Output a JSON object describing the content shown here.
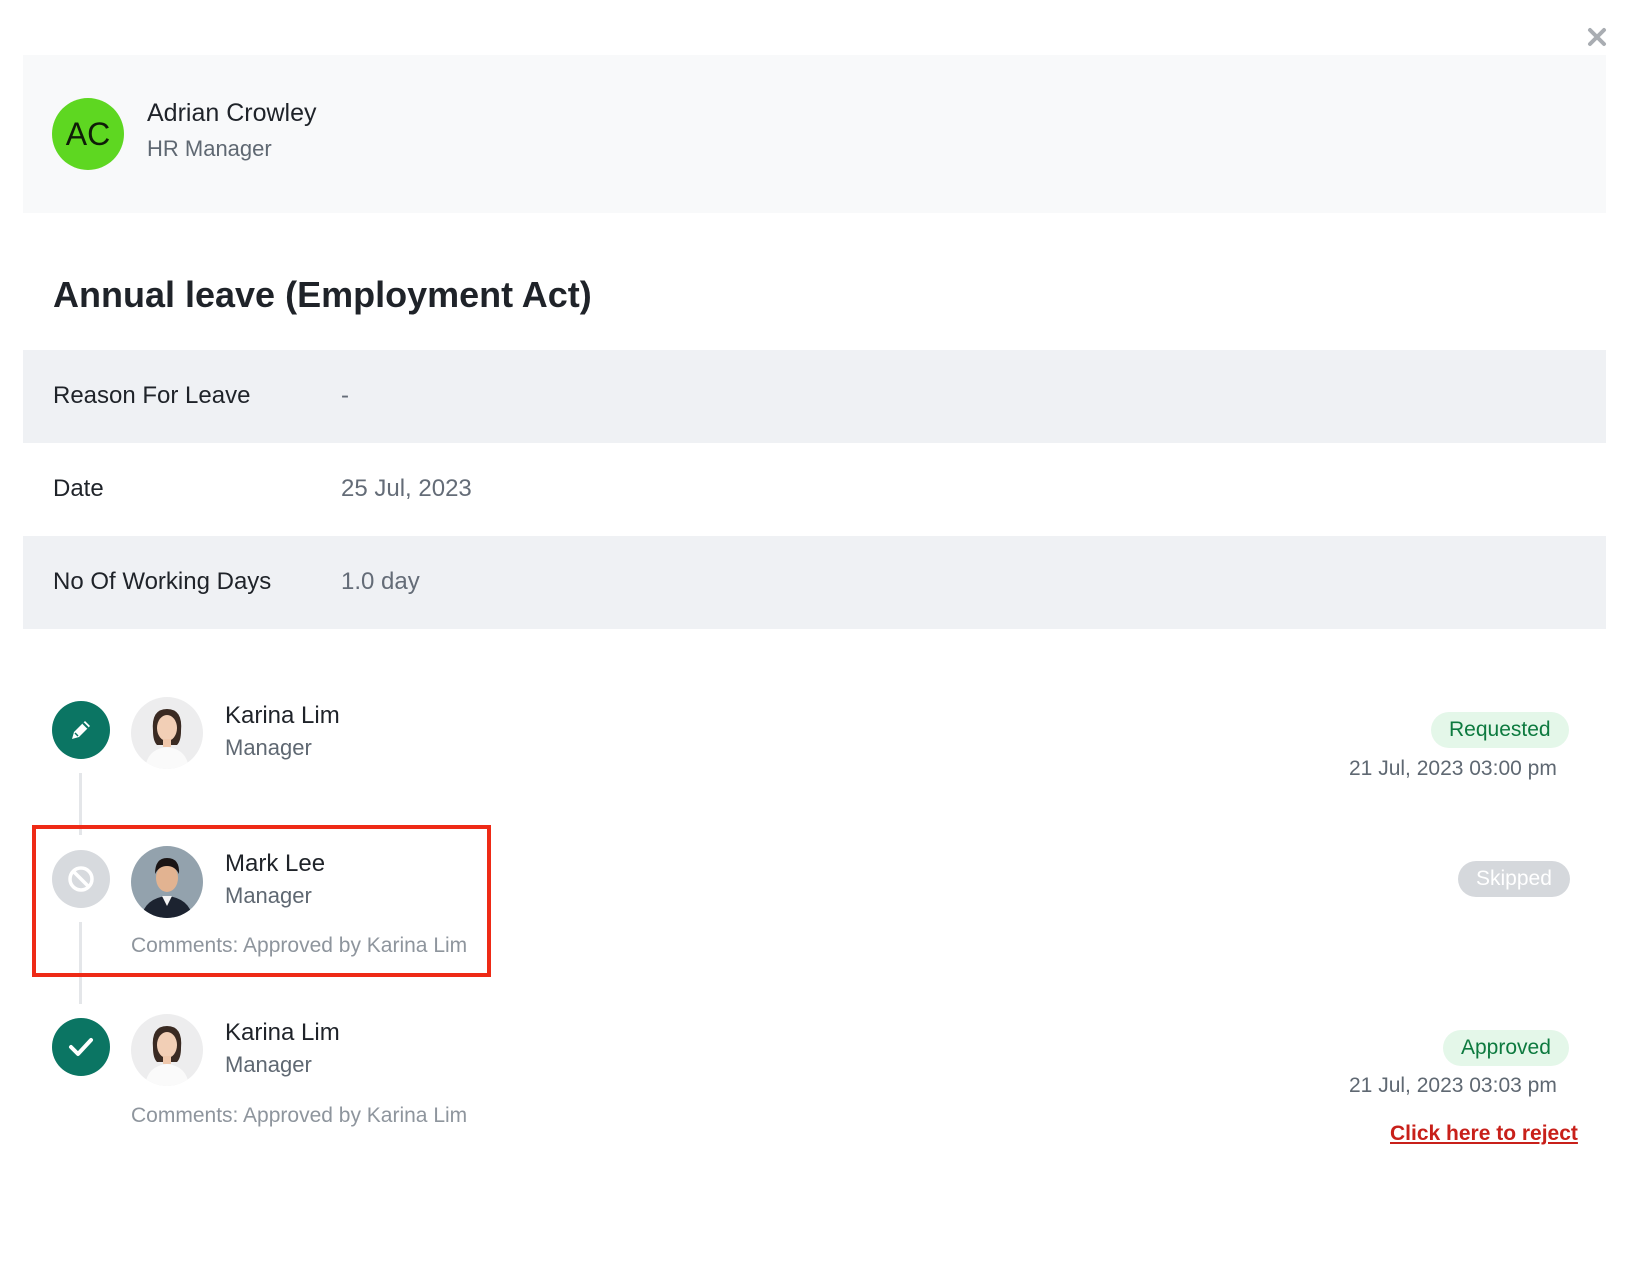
{
  "header": {
    "initials": "AC",
    "name": "Adrian Crowley",
    "role": "HR Manager",
    "avatar_color": "#5ed721"
  },
  "leave": {
    "title": "Annual leave (Employment Act)",
    "details": [
      {
        "label": "Reason For Leave",
        "value": "-"
      },
      {
        "label": "Date",
        "value": "25 Jul, 2023"
      },
      {
        "label": "No Of Working Days",
        "value": "1.0 day"
      }
    ]
  },
  "timeline": [
    {
      "icon": "pencil-icon",
      "name": "Karina Lim",
      "role": "Manager",
      "status": "Requested",
      "timestamp": "21 Jul, 2023 03:00 pm"
    },
    {
      "icon": "ban-icon",
      "name": "Mark Lee",
      "role": "Manager",
      "status": "Skipped",
      "comment": "Comments: Approved by Karina Lim"
    },
    {
      "icon": "check-icon",
      "name": "Karina Lim",
      "role": "Manager",
      "status": "Approved",
      "timestamp": "21 Jul, 2023 03:03 pm",
      "comment": "Comments: Approved by Karina Lim",
      "action": "Click here to reject"
    }
  ],
  "colors": {
    "teal": "#0b7563",
    "reject": "#c8201a",
    "highlight": "#ee2a16"
  }
}
